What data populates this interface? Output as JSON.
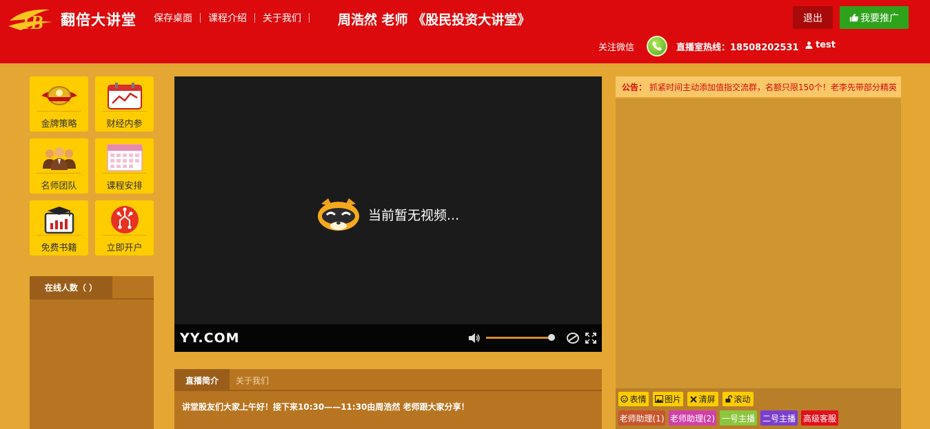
{
  "header": {
    "brand": "翻倍大讲堂",
    "nav": [
      "保存桌面",
      "课程介绍",
      "关于我们"
    ],
    "title": "周浩然 老师 《股民投资大讲堂》",
    "logout": "退出",
    "promote": "我要推广",
    "follow": "关注微信",
    "hotline": "直播室热线：18508202531",
    "user": "test"
  },
  "tiles": [
    {
      "label": "金牌策略",
      "icon": "gold-medal-icon"
    },
    {
      "label": "财经内参",
      "icon": "calendar-chart-icon"
    },
    {
      "label": "名师团队",
      "icon": "team-icon"
    },
    {
      "label": "课程安排",
      "icon": "schedule-icon"
    },
    {
      "label": "免费书籍",
      "icon": "graduation-book-icon"
    },
    {
      "label": "立即开户",
      "icon": "circuit-icon"
    }
  ],
  "online": {
    "label": "在线人数（ ）"
  },
  "video": {
    "message": "当前暂无视频...",
    "brand": "YY.COM",
    "volume": 0.95
  },
  "intro": {
    "tabs": [
      "直播简介",
      "关于我们"
    ],
    "text": "讲堂股友们大家上午好！接下来10:30——11:30由周浩然 老师跟大家分享！"
  },
  "chat": {
    "notice_label": "公告：",
    "notice_text": "抓紧时间主动添加值指交流群，名额只限150个！老李先带部分精英",
    "tools": [
      "表情",
      "图片",
      "清屏",
      "滚动"
    ],
    "roles": [
      {
        "label": "老师助理(1)",
        "color": "#c8552d"
      },
      {
        "label": "老师助理(2)",
        "color": "#d13fa8"
      },
      {
        "label": "一号主播",
        "color": "#8cc63f"
      },
      {
        "label": "二号主播",
        "color": "#7a3fcf"
      },
      {
        "label": "高级客服",
        "color": "#e2101b"
      }
    ]
  },
  "colors": {
    "header": "#dd0a0d",
    "background": "#e4a733",
    "tile": "#ffcc00",
    "promote": "#2fa21c"
  }
}
